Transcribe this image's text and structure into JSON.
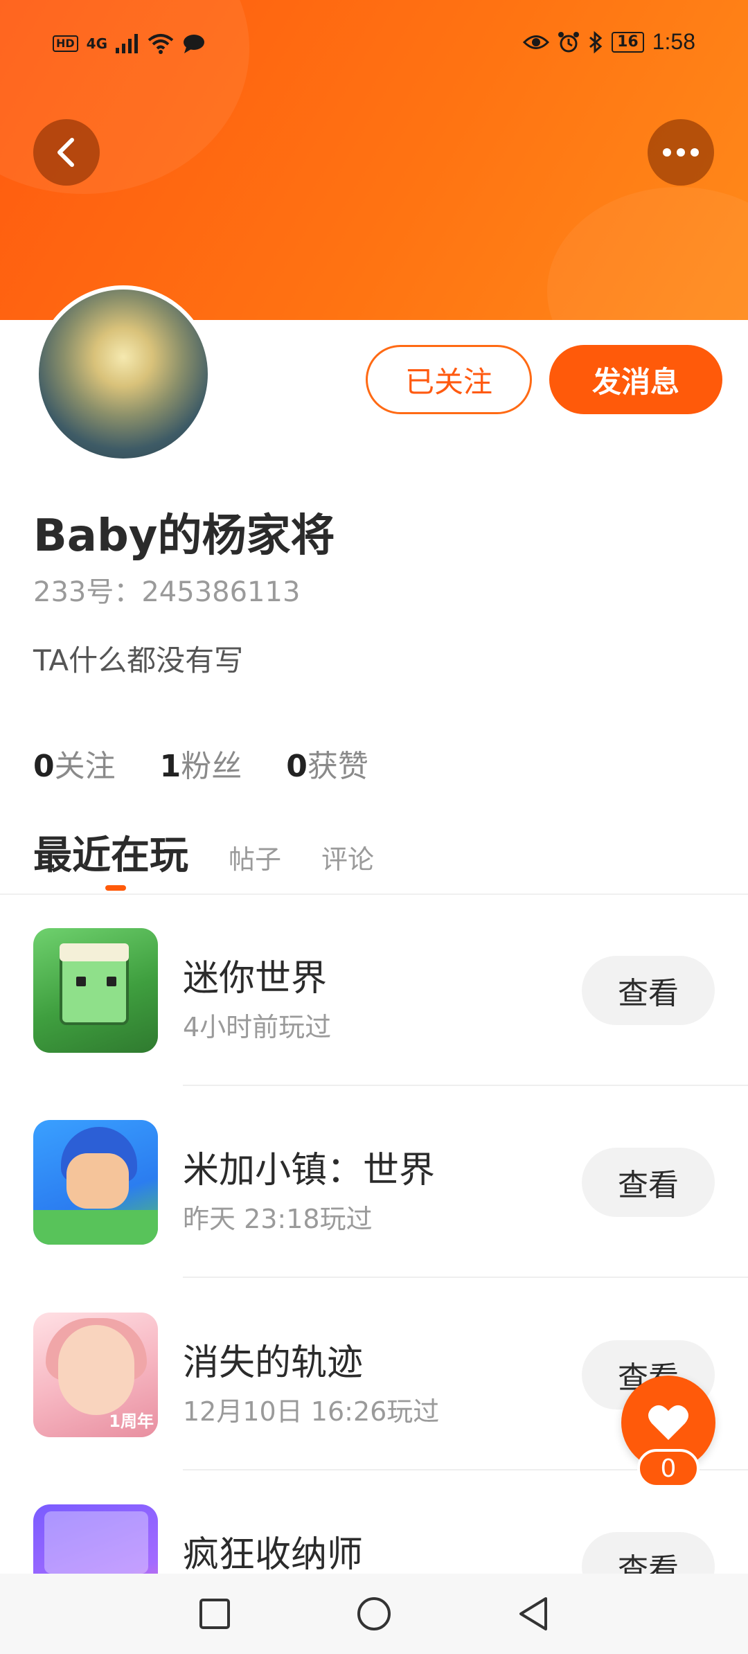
{
  "status_bar": {
    "left": {
      "hd": "HD",
      "network": "4G"
    },
    "right": {
      "battery": "16",
      "time": "1:58"
    }
  },
  "profile": {
    "username": "Baby的杨家将",
    "id_line": "233号：245386113",
    "bio": "TA什么都没有写"
  },
  "actions": {
    "followed": "已关注",
    "message": "发消息"
  },
  "stats": [
    {
      "count": "0",
      "label": "关注"
    },
    {
      "count": "1",
      "label": "粉丝"
    },
    {
      "count": "0",
      "label": "获赞"
    }
  ],
  "tabs": {
    "active": "最近在玩",
    "posts": "帖子",
    "comments": "评论"
  },
  "games": [
    {
      "title": "迷你世界",
      "time": "4小时前玩过",
      "button": "查看"
    },
    {
      "title": "米加小镇：世界",
      "time": "昨天 23:18玩过",
      "button": "查看"
    },
    {
      "title": "消失的轨迹",
      "time": "12月10日 16:26玩过",
      "button": "查看",
      "icon_tag": "1周年"
    },
    {
      "title": "疯狂收纳师",
      "time": "",
      "button": "查看"
    }
  ],
  "like": {
    "count": "0"
  },
  "colors": {
    "accent": "#ff5a0a",
    "header": "#ff7312"
  },
  "icons": {
    "back": "chevron-left-icon",
    "more": "more-dots-icon",
    "heart": "heart-icon",
    "nav": [
      "square-icon",
      "circle-icon",
      "triangle-back-icon"
    ]
  }
}
